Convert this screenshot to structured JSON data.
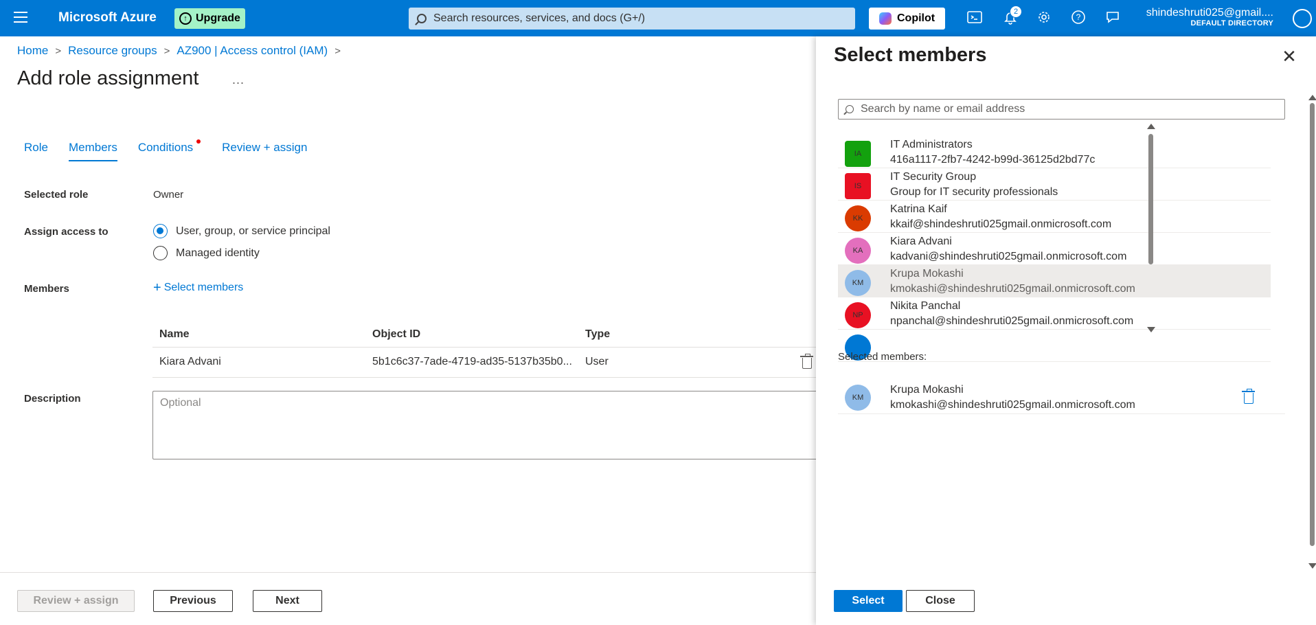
{
  "topbar": {
    "brand": "Microsoft Azure",
    "upgrade_label": "Upgrade",
    "search_placeholder": "Search resources, services, and docs (G+/)",
    "copilot_label": "Copilot",
    "notification_count": "2",
    "user_email": "shindeshruti025@gmail....",
    "user_directory": "DEFAULT DIRECTORY"
  },
  "breadcrumb": [
    "Home",
    "Resource groups",
    "AZ900 | Access control (IAM)"
  ],
  "page_title": "Add role assignment",
  "more_label": "...",
  "tabs": [
    "Role",
    "Members",
    "Conditions",
    "Review + assign"
  ],
  "form": {
    "selected_role_label": "Selected role",
    "selected_role_value": "Owner",
    "assign_access_label": "Assign access to",
    "assign_options": [
      "User, group, or service principal",
      "Managed identity"
    ],
    "members_label": "Members",
    "select_members_link": "Select members",
    "table_headers": [
      "Name",
      "Object ID",
      "Type"
    ],
    "table_rows": [
      {
        "name": "Kiara Advani",
        "object_id": "5b1c6c37-7ade-4719-ad35-5137b35b0...",
        "type": "User"
      }
    ],
    "description_label": "Description",
    "description_placeholder": "Optional"
  },
  "footer": {
    "review_assign": "Review + assign",
    "previous": "Previous",
    "next": "Next"
  },
  "panel": {
    "title": "Select members",
    "search_placeholder": "Search by name or email address",
    "items": [
      {
        "initials": "IA",
        "name": "IT Administrators",
        "sub": "416a1117-2fb7-4242-b99d-36125d2bd77c",
        "color": "#13a10e",
        "shape": "square"
      },
      {
        "initials": "IS",
        "name": "IT Security Group",
        "sub": "Group for IT security professionals",
        "color": "#e81123",
        "shape": "square"
      },
      {
        "initials": "KK",
        "name": "Katrina Kaif",
        "sub": "kkaif@shindeshruti025gmail.onmicrosoft.com",
        "color": "#da3b01",
        "shape": "round"
      },
      {
        "initials": "KA",
        "name": "Kiara Advani",
        "sub": "kadvani@shindeshruti025gmail.onmicrosoft.com",
        "color": "#e3008c",
        "shape": "round"
      },
      {
        "initials": "KM",
        "name": "Krupa Mokashi",
        "sub": "kmokashi@shindeshruti025gmail.onmicrosoft.com",
        "color": "#71afe5",
        "shape": "round"
      },
      {
        "initials": "NP",
        "name": "Nikita Panchal",
        "sub": "npanchal@shindeshruti025gmail.onmicrosoft.com",
        "color": "#e81123",
        "shape": "round"
      }
    ],
    "selected_label": "Selected members:",
    "selected": {
      "initials": "KM",
      "name": "Krupa Mokashi",
      "sub": "kmokashi@shindeshruti025gmail.onmicrosoft.com",
      "color": "#71afe5"
    },
    "select_button": "Select",
    "close_button": "Close"
  }
}
